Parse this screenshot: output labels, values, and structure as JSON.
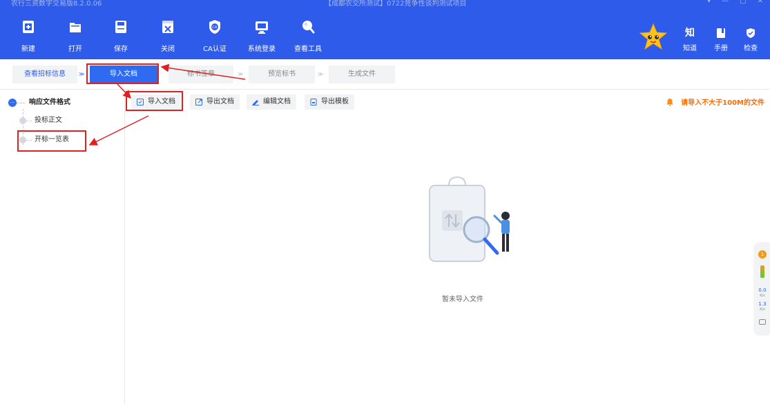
{
  "window": {
    "title_left": "农行三资数字交易版8.2.0.06",
    "title_center": "【成都农交所测试】0722竞争性谈判测试项目",
    "controls": [
      "▾",
      "—",
      "▢",
      "✕"
    ]
  },
  "toolbar": {
    "items": [
      {
        "label": "新建",
        "icon": "new-doc-icon"
      },
      {
        "label": "打开",
        "icon": "folder-open-icon"
      },
      {
        "label": "保存",
        "icon": "save-icon"
      },
      {
        "label": "关闭",
        "icon": "close-doc-icon"
      },
      {
        "label": "CA认证",
        "icon": "ca-shield-icon"
      },
      {
        "label": "系统登录",
        "icon": "monitor-icon"
      },
      {
        "label": "查看工具",
        "icon": "search-tool-icon"
      }
    ],
    "right_items": [
      {
        "label": "知道",
        "icon": "knowledge-icon",
        "glyph": "知"
      },
      {
        "label": "手册",
        "icon": "manual-icon"
      },
      {
        "label": "检查",
        "icon": "check-shield-icon"
      }
    ]
  },
  "steps": {
    "items": [
      "查看招标信息",
      "导入文档",
      "标书签章",
      "预览标书",
      "生成文件"
    ],
    "active_index": 1,
    "separator": "≫"
  },
  "sidebar": {
    "root_label": "响应文件格式",
    "root_glyph": "···",
    "items": [
      "投标正文",
      "开标一览表"
    ]
  },
  "doc_actions": [
    "导入文档",
    "导出文档",
    "编辑文档",
    "导出模板"
  ],
  "notice": "请导入不大于100M的文件",
  "empty_state": "暂未导入文件",
  "float_widget": {
    "badge": "1",
    "stat1": "0.0",
    "stat1_unit": "K/s",
    "stat2": "1.3",
    "stat2_unit": "K/s"
  },
  "colors": {
    "header": "#2f5bea",
    "accent": "#2f6bf0",
    "notice": "#ff6a00",
    "annotation": "#e02020"
  }
}
